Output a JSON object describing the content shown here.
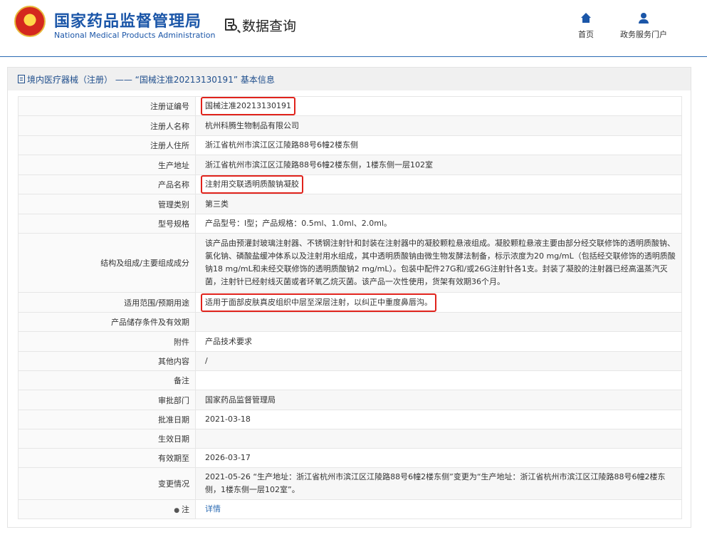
{
  "header": {
    "site_name_cn": "国家药品监督管理局",
    "site_name_en": "National Medical Products Administration",
    "section_title": "数据查询",
    "nav": [
      {
        "label": "首页",
        "icon": "home-icon"
      },
      {
        "label": "政务服务门户",
        "icon": "user-icon"
      }
    ]
  },
  "panel": {
    "title": "境内医疗器械（注册） ——  “国械注准20213130191”  基本信息"
  },
  "rows": [
    {
      "label": "注册证编号",
      "value": "国械注准20213130191",
      "highlighted": true
    },
    {
      "label": "注册人名称",
      "value": "杭州科腾生物制品有限公司"
    },
    {
      "label": "注册人住所",
      "value": "浙江省杭州市滨江区江陵路88号6幢2楼东侧"
    },
    {
      "label": "生产地址",
      "value": "浙江省杭州市滨江区江陵路88号6幢2楼东侧，1楼东侧一层102室"
    },
    {
      "label": "产品名称",
      "value": "注射用交联透明质酸钠凝胶",
      "highlighted": true
    },
    {
      "label": "管理类别",
      "value": "第三类"
    },
    {
      "label": "型号规格",
      "value": "产品型号：Ⅰ型；产品规格：0.5ml、1.0ml、2.0ml。"
    },
    {
      "label": "结构及组成/主要组成成分",
      "value": "该产品由预灌封玻璃注射器、不锈钢注射针和封装在注射器中的凝胶颗粒悬液组成。凝胶颗粒悬液主要由部分经交联修饰的透明质酸钠、氯化钠、磷酸盐缓冲体系以及注射用水组成，其中透明质酸钠由微生物发酵法制备，标示浓度为20 mg/mL（包括经交联修饰的透明质酸钠18 mg/mL和未经交联修饰的透明质酸钠2 mg/mL）。包装中配件27G和/或26G注射针各1支。封装了凝胶的注射器已经高温蒸汽灭菌，注射针已经射线灭菌或者环氧乙烷灭菌。该产品一次性使用，货架有效期36个月。"
    },
    {
      "label": "适用范围/预期用途",
      "value": "适用于面部皮肤真皮组织中层至深层注射，以纠正中重度鼻唇沟。",
      "highlighted": true
    },
    {
      "label": "产品储存条件及有效期",
      "value": ""
    },
    {
      "label": "附件",
      "value": "产品技术要求"
    },
    {
      "label": "其他内容",
      "value": "/"
    },
    {
      "label": "备注",
      "value": ""
    },
    {
      "label": "审批部门",
      "value": "国家药品监督管理局"
    },
    {
      "label": "批准日期",
      "value": "2021-03-18"
    },
    {
      "label": "生效日期",
      "value": ""
    },
    {
      "label": "有效期至",
      "value": "2026-03-17"
    },
    {
      "label": "变更情况",
      "value": "2021-05-26 “生产地址：浙江省杭州市滨江区江陵路88号6幢2楼东侧”变更为“生产地址：浙江省杭州市滨江区江陵路88号6幢2楼东侧，1楼东侧一层102室”。"
    },
    {
      "label": "注",
      "value": "详情",
      "is_link": true,
      "icon": "pin-icon"
    }
  ],
  "colors": {
    "brand": "#1b56a8",
    "highlight_border": "#e0231c",
    "link": "#2b6bb3"
  }
}
